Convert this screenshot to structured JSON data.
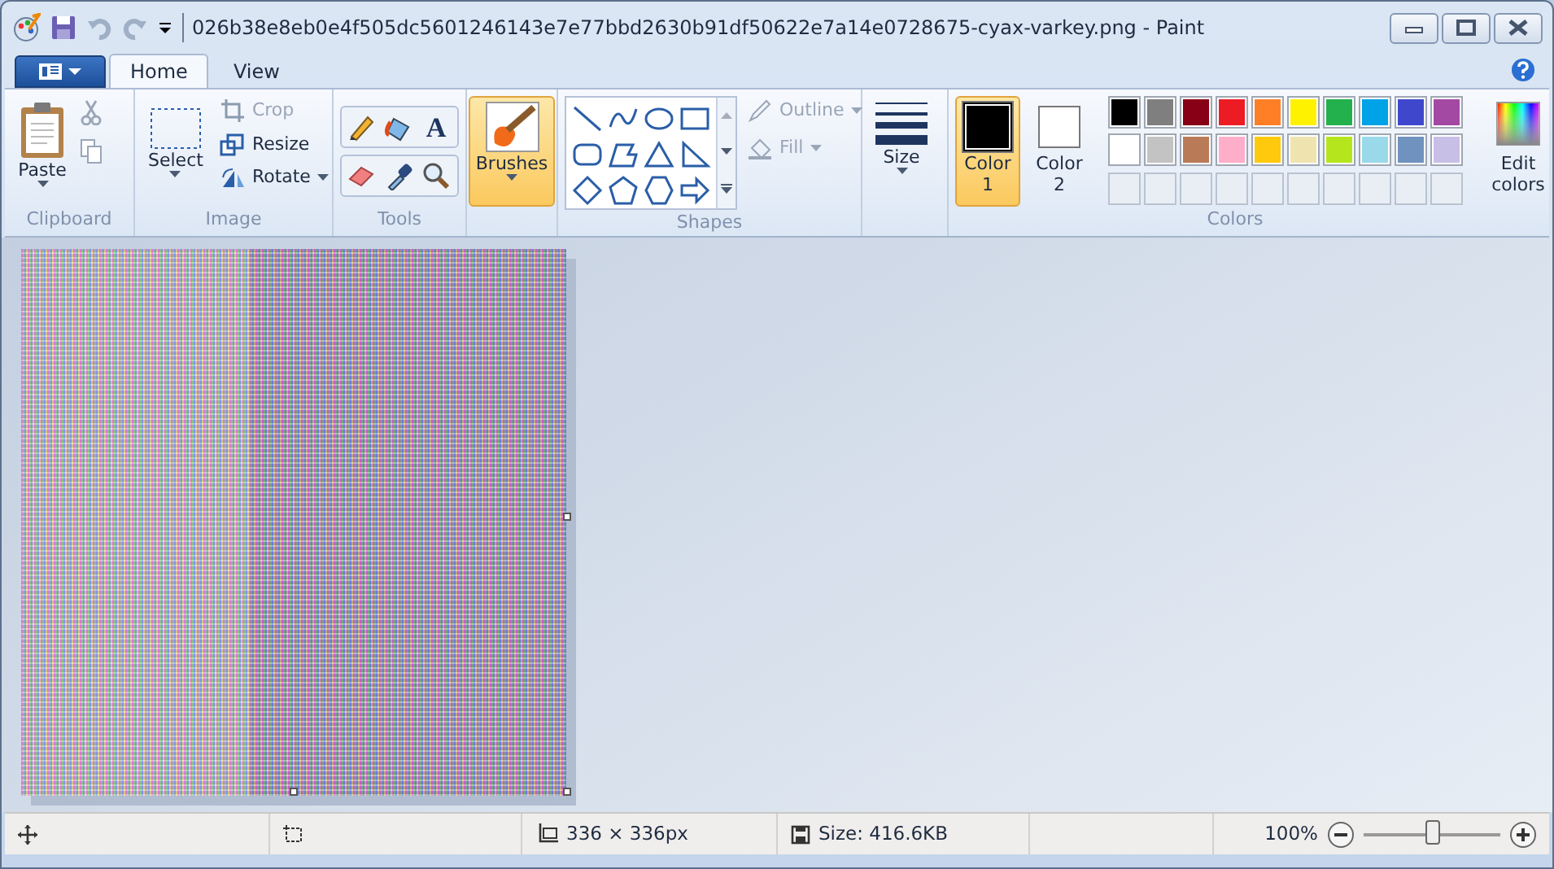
{
  "window": {
    "title": "026b38e8eb0e4f505dc5601246143e7e77bbd2630b91df50622e7a14e0728675-cyax-varkey.png - Paint"
  },
  "tabs": [
    {
      "label": "Home",
      "selected": true
    },
    {
      "label": "View",
      "selected": false
    }
  ],
  "ribbon": {
    "clipboard": {
      "label": "Clipboard",
      "paste": "Paste"
    },
    "image": {
      "label": "Image",
      "select": "Select",
      "actions": [
        {
          "kind": "crop",
          "label": "Crop",
          "disabled": true
        },
        {
          "kind": "resize",
          "label": "Resize",
          "disabled": false
        },
        {
          "kind": "rotate",
          "label": "Rotate",
          "disabled": false
        }
      ]
    },
    "tools": {
      "label": "Tools",
      "text_glyph": "A"
    },
    "brushes": {
      "label": "Brushes",
      "selected": true
    },
    "shapes": {
      "label": "Shapes",
      "outline": {
        "label": "Outline",
        "disabled": true
      },
      "fill": {
        "label": "Fill",
        "disabled": true
      }
    },
    "size": {
      "label": "Size"
    },
    "colors": {
      "label": "Colors",
      "slots": [
        {
          "label": "Color",
          "number": "1",
          "color": "#000000",
          "selected": true
        },
        {
          "label": "Color",
          "number": "2",
          "color": "#ffffff",
          "selected": false
        }
      ],
      "palette": [
        {
          "color": "#000000"
        },
        {
          "color": "#7f7f7f"
        },
        {
          "color": "#880015"
        },
        {
          "color": "#ed1c24"
        },
        {
          "color": "#ff7f27"
        },
        {
          "color": "#fff200"
        },
        {
          "color": "#22b14c"
        },
        {
          "color": "#00a2e8"
        },
        {
          "color": "#3f48cc"
        },
        {
          "color": "#a349a4"
        },
        {
          "color": "#ffffff"
        },
        {
          "color": "#c3c3c3"
        },
        {
          "color": "#b97a57"
        },
        {
          "color": "#ffaec9"
        },
        {
          "color": "#ffc90e"
        },
        {
          "color": "#efe4b0"
        },
        {
          "color": "#b5e61d"
        },
        {
          "color": "#99d9ea"
        },
        {
          "color": "#7092be"
        },
        {
          "color": "#c8bfe7"
        }
      ],
      "custom": [
        {
          "filled": false
        },
        {
          "filled": false
        },
        {
          "filled": false
        },
        {
          "filled": false
        },
        {
          "filled": false
        },
        {
          "filled": false
        },
        {
          "filled": false
        },
        {
          "filled": false
        },
        {
          "filled": false
        },
        {
          "filled": false
        }
      ],
      "edit": "Edit colors"
    }
  },
  "status_bar": {
    "dimensions": "336 × 336px",
    "file_size": "Size: 416.6KB",
    "zoom": "100%",
    "zoom_slider": {
      "level": 0.5
    }
  }
}
